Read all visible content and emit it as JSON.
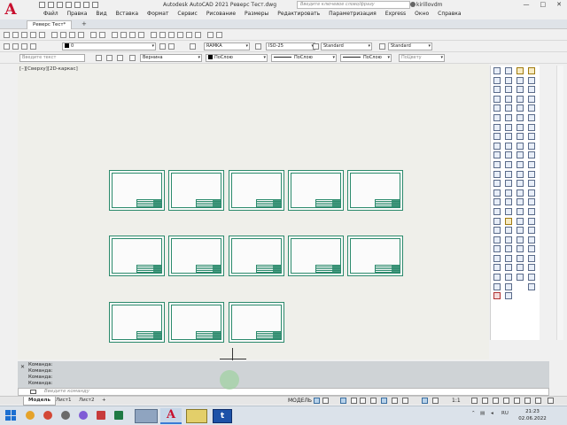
{
  "window": {
    "title": "Autodesk AutoCAD 2021   Реверс Тест.dwg",
    "search_placeholder": "Введите ключевое слово/фразу",
    "user": "kirillovdm",
    "controls": [
      "—",
      "□",
      "✕"
    ]
  },
  "menu": [
    "Файл",
    "Правка",
    "Вид",
    "Вставка",
    "Формат",
    "Сервис",
    "Рисование",
    "Размеры",
    "Редактировать",
    "Параметризация",
    "Express",
    "Окно",
    "Справка"
  ],
  "doc_tab": {
    "label": "Реверс Тест*",
    "add": "+"
  },
  "toolbar2": {
    "layer_value": "0",
    "textstyle": "RAMKA",
    "dimstyle": "ISO-25",
    "tablestyle": "Standard",
    "mleaderstyle": "Standard"
  },
  "toolbar3": {
    "text_placeholder": "Введите текст",
    "layer": "Вернина",
    "color": "ПоСлою",
    "linetype": "ПоСлою",
    "lineweight": "ПоСлою",
    "plotstyle": "ПоЦвету"
  },
  "viewport": {
    "label": "[–][Сверху][2D-каркас]"
  },
  "command": {
    "history": [
      "Команда:",
      "Команда:",
      "Команда:",
      "Команда:"
    ],
    "placeholder": "Введите команду",
    "close_glyph": "✕"
  },
  "layout_tabs": [
    {
      "label": "Модель",
      "active": true
    },
    {
      "label": "Лист1",
      "active": false
    },
    {
      "label": "Лист2",
      "active": false
    },
    {
      "label": "+",
      "active": false
    }
  ],
  "status": {
    "model_label": "МОДЕЛЬ",
    "scale": "1:1"
  },
  "taskbar": {
    "autocad_label": "A",
    "teamviewer_label": "t",
    "lang": "RU",
    "time": "21:23",
    "date": "02.06.2022"
  },
  "colors": {
    "sheet_stroke": "#2b8a6c",
    "canvas": "#efefea",
    "autocad_red": "#c8102e"
  },
  "icons": [
    "autocad-logo-icon",
    "new-file-icon",
    "open-icon",
    "save-icon",
    "undo-icon",
    "redo-icon",
    "search-icon",
    "user-icon",
    "layer-icon",
    "color-swatch-icon",
    "crosshair-icon",
    "grid-icon",
    "snap-icon",
    "windows-start-icon",
    "teamviewer-icon"
  ]
}
